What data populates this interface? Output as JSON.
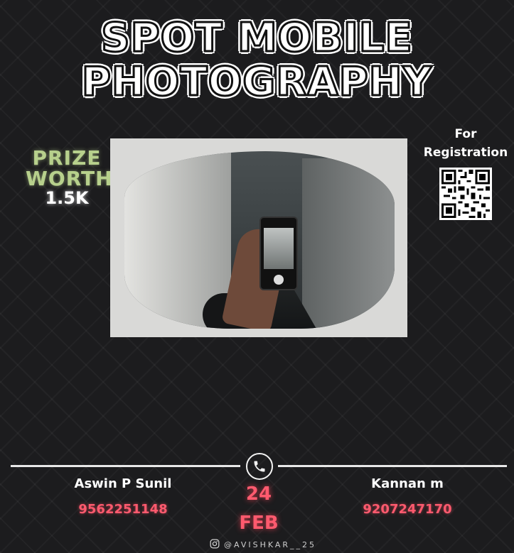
{
  "title": {
    "line1": "SPOT MOBILE",
    "line2": "PHOTOGRAPHY"
  },
  "prize": {
    "line1": "PRIZE",
    "line2": "WORTH",
    "amount": "1.5K"
  },
  "registration": {
    "line1": "For",
    "line2": "Registration",
    "qr_icon": "qr-code-icon"
  },
  "contacts": [
    {
      "name": "Aswin P Sunil",
      "phone": "9562251148"
    },
    {
      "name": "Kannan m",
      "phone": "9207247170"
    }
  ],
  "date": {
    "day": "24",
    "month": "FEB"
  },
  "social": {
    "icon": "instagram-icon",
    "handle": "@AVISHKAR__25"
  },
  "colors": {
    "background": "#1c1c1e",
    "prize_green": "#b7d08c",
    "accent_red": "#ff5a6e",
    "white": "#ffffff"
  }
}
